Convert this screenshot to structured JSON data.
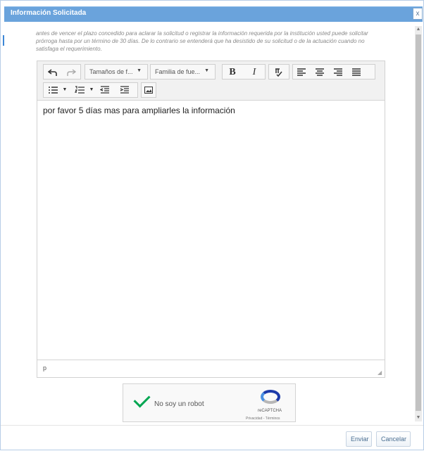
{
  "dialog": {
    "title": "Información Solicitada",
    "close_label": "x",
    "instruction": "antes de vencer el plazo concedido para aclarar la solicitud o registrar la información requerida por la institución usted puede solicitar prórroga hasta por un término de 30 días. De lo contrario se entenderá que ha desistido de su solicitud o de la actuación cuando no satisfaga el requerimiento."
  },
  "editor": {
    "font_size_placeholder": "Tamaños de f...",
    "font_family_placeholder": "Familia de fue...",
    "bold_label": "B",
    "italic_label": "I",
    "content": "por favor 5 días mas para ampliarles la información",
    "path": "p"
  },
  "captcha": {
    "label": "No soy un robot",
    "brand": "reCAPTCHA",
    "links": "Privacidad - Términos"
  },
  "footer": {
    "send_label": "Enviar",
    "cancel_label": "Cancelar"
  },
  "icons": {
    "close": "close-icon",
    "undo": "undo-icon",
    "redo": "redo-icon",
    "spellcheck": "spellcheck-icon",
    "image": "image-icon"
  }
}
